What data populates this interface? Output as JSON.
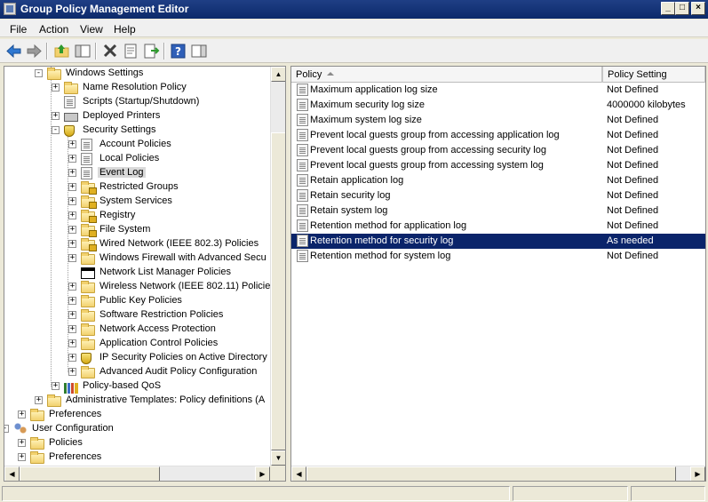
{
  "window": {
    "title": "Group Policy Management Editor",
    "minimize": "_",
    "maximize": "□",
    "close": "×"
  },
  "menu": [
    {
      "label": "File"
    },
    {
      "label": "Action"
    },
    {
      "label": "View"
    },
    {
      "label": "Help"
    }
  ],
  "toolbar": {
    "icons": [
      "back-icon",
      "forward-icon",
      "up-folder-icon",
      "show-hide-tree-icon",
      "delete-icon",
      "properties-icon",
      "export-list-icon",
      "help-icon",
      "show-action-pane-icon"
    ]
  },
  "tree": {
    "nodes": [
      {
        "label": "Windows Settings",
        "icon": "folder",
        "expander": "-"
      },
      {
        "label": "Name Resolution Policy",
        "icon": "folder",
        "expander": "+"
      },
      {
        "label": "Scripts (Startup/Shutdown)",
        "icon": "document",
        "expander": ""
      },
      {
        "label": "Deployed Printers",
        "icon": "printer",
        "expander": "+"
      },
      {
        "label": "Security Settings",
        "icon": "shield",
        "expander": "-"
      },
      {
        "label": "Account Policies",
        "icon": "document",
        "expander": "+"
      },
      {
        "label": "Local Policies",
        "icon": "document",
        "expander": "+"
      },
      {
        "label": "Event Log",
        "icon": "document",
        "expander": "+"
      },
      {
        "label": "Restricted Groups",
        "icon": "folder-lock",
        "expander": "+"
      },
      {
        "label": "System Services",
        "icon": "folder-lock",
        "expander": "+"
      },
      {
        "label": "Registry",
        "icon": "folder-lock",
        "expander": "+"
      },
      {
        "label": "File System",
        "icon": "folder-lock",
        "expander": "+"
      },
      {
        "label": "Wired Network (IEEE 802.3) Policies",
        "icon": "folder-lock",
        "expander": "+"
      },
      {
        "label": "Windows Firewall with Advanced Secu",
        "icon": "folder",
        "expander": "+"
      },
      {
        "label": "Network List Manager Policies",
        "icon": "blackbox",
        "expander": ""
      },
      {
        "label": "Wireless Network (IEEE 802.11) Policie",
        "icon": "network",
        "expander": "+"
      },
      {
        "label": "Public Key Policies",
        "icon": "folder",
        "expander": "+"
      },
      {
        "label": "Software Restriction Policies",
        "icon": "folder",
        "expander": "+"
      },
      {
        "label": "Network Access Protection",
        "icon": "folder",
        "expander": "+"
      },
      {
        "label": "Application Control Policies",
        "icon": "folder",
        "expander": "+"
      },
      {
        "label": "IP Security Policies on Active Directory",
        "icon": "ipsec",
        "expander": "+"
      },
      {
        "label": "Advanced Audit Policy Configuration",
        "icon": "folder",
        "expander": "+"
      },
      {
        "label": "Policy-based QoS",
        "icon": "bars",
        "expander": "+"
      },
      {
        "label": "Administrative Templates: Policy definitions (A",
        "icon": "folder",
        "expander": "+"
      },
      {
        "label": "Preferences",
        "icon": "folder",
        "expander": "+"
      },
      {
        "label": "User Configuration",
        "icon": "users",
        "expander": "-"
      },
      {
        "label": "Policies",
        "icon": "folder",
        "expander": "+"
      },
      {
        "label": "Preferences",
        "icon": "folder",
        "expander": "+"
      }
    ]
  },
  "list": {
    "columns": {
      "policy": "Policy",
      "setting": "Policy Setting"
    },
    "rows": [
      {
        "policy": "Maximum application log size",
        "setting": "Not Defined"
      },
      {
        "policy": "Maximum security log size",
        "setting": "4000000 kilobytes"
      },
      {
        "policy": "Maximum system log size",
        "setting": "Not Defined"
      },
      {
        "policy": "Prevent local guests group from accessing application log",
        "setting": "Not Defined"
      },
      {
        "policy": "Prevent local guests group from accessing security log",
        "setting": "Not Defined"
      },
      {
        "policy": "Prevent local guests group from accessing system log",
        "setting": "Not Defined"
      },
      {
        "policy": "Retain application log",
        "setting": "Not Defined"
      },
      {
        "policy": "Retain security log",
        "setting": "Not Defined"
      },
      {
        "policy": "Retain system log",
        "setting": "Not Defined"
      },
      {
        "policy": "Retention method for application log",
        "setting": "Not Defined"
      },
      {
        "policy": "Retention method for security log",
        "setting": "As needed"
      },
      {
        "policy": "Retention method for system log",
        "setting": "Not Defined"
      }
    ]
  },
  "colors": {
    "titlebar": "#0c2a6a",
    "selection": "#0a246a",
    "chrome": "#ece9d8"
  }
}
